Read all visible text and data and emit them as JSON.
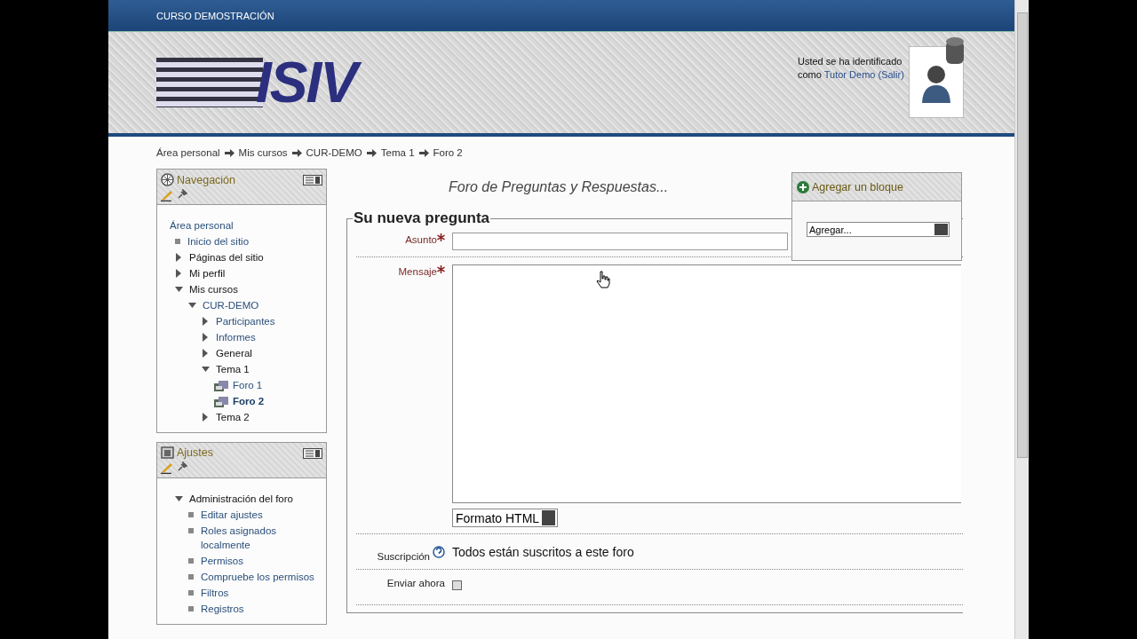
{
  "header": {
    "course_name": "CURSO DEMOSTRACIÓN",
    "logo": "ISIV",
    "login": {
      "line1": "Usted se ha identificado",
      "prefix": "como",
      "user": "Tutor Demo",
      "logout": "(Salir)"
    }
  },
  "breadcrumb": [
    "Área personal",
    "Mis cursos",
    "CUR-DEMO",
    "Tema 1",
    "Foro 2"
  ],
  "navigation": {
    "title": "Navegación",
    "items": [
      {
        "kind": "home",
        "label": "Área personal",
        "link": true
      },
      {
        "kind": "leaf",
        "label": "Inicio del sitio",
        "link": true
      },
      {
        "kind": "branch",
        "label": "Páginas del sitio",
        "link": false,
        "expanded": false
      },
      {
        "kind": "branch",
        "label": "Mi perfil",
        "link": false,
        "expanded": false
      },
      {
        "kind": "branch",
        "label": "Mis cursos",
        "link": false,
        "expanded": true,
        "children": [
          {
            "kind": "branch",
            "label": "CUR-DEMO",
            "link": true,
            "expanded": true,
            "children": [
              {
                "kind": "branch",
                "label": "Participantes",
                "link": true,
                "expanded": false
              },
              {
                "kind": "branch",
                "label": "Informes",
                "link": true,
                "expanded": false
              },
              {
                "kind": "branch",
                "label": "General",
                "link": false,
                "expanded": false
              },
              {
                "kind": "branch",
                "label": "Tema 1",
                "link": false,
                "expanded": true,
                "children": [
                  {
                    "kind": "forum",
                    "label": "Foro 1",
                    "link": true,
                    "selected": false
                  },
                  {
                    "kind": "forum",
                    "label": "Foro 2",
                    "link": true,
                    "selected": true
                  }
                ]
              },
              {
                "kind": "branch",
                "label": "Tema 2",
                "link": false,
                "expanded": false
              }
            ]
          }
        ]
      }
    ]
  },
  "settings": {
    "title": "Ajustes",
    "items": [
      {
        "kind": "branch",
        "label": "Administración del foro",
        "link": false,
        "expanded": true,
        "children": [
          {
            "kind": "leaf",
            "label": "Editar ajustes",
            "link": true
          },
          {
            "kind": "leaf",
            "label": "Roles asignados localmente",
            "link": true
          },
          {
            "kind": "leaf",
            "label": "Permisos",
            "link": true
          },
          {
            "kind": "leaf",
            "label": "Compruebe los permisos",
            "link": true
          },
          {
            "kind": "leaf",
            "label": "Filtros",
            "link": true
          },
          {
            "kind": "leaf",
            "label": "Registros",
            "link": true
          }
        ]
      }
    ]
  },
  "forum_title": "Foro de Preguntas y Respuestas...",
  "form": {
    "legend": "Su nueva pregunta",
    "subject": {
      "label": "Asunto",
      "required": true
    },
    "message": {
      "label": "Mensaje",
      "required": true,
      "format": "Formato HTML"
    },
    "subscription": {
      "label": "Suscripción",
      "value": "Todos están suscritos a este foro"
    },
    "send_now": {
      "label": "Enviar ahora",
      "checked": false
    }
  },
  "add_block": {
    "title": "Agregar un bloque",
    "select": "Agregar..."
  }
}
